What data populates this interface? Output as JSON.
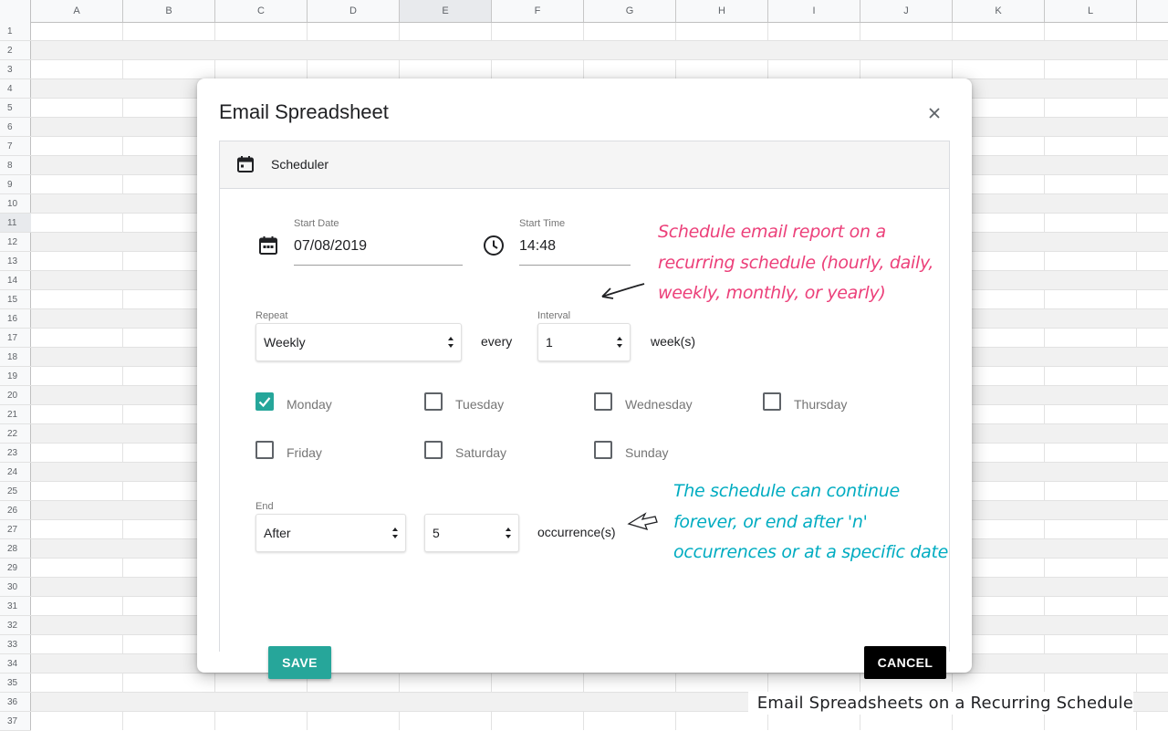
{
  "sheet": {
    "columns": [
      "A",
      "B",
      "C",
      "D",
      "E",
      "F",
      "G",
      "H",
      "I",
      "J",
      "K",
      "L"
    ],
    "selected_column": "E",
    "rows": [
      "1",
      "2",
      "3",
      "4",
      "5",
      "6",
      "7",
      "8",
      "9",
      "10",
      "11",
      "12",
      "13",
      "14",
      "15",
      "16",
      "17",
      "18",
      "19",
      "20",
      "21",
      "22",
      "23",
      "24",
      "25",
      "26",
      "27",
      "28",
      "29",
      "30",
      "31",
      "32",
      "33",
      "34",
      "35",
      "36",
      "37"
    ],
    "selected_row": "11"
  },
  "dialog": {
    "title": "Email Spreadsheet",
    "section_label": "Scheduler",
    "start_date": {
      "label": "Start Date",
      "value": "07/08/2019"
    },
    "start_time": {
      "label": "Start Time",
      "value": "14:48"
    },
    "repeat": {
      "label": "Repeat",
      "value": "Weekly"
    },
    "every_text": "every",
    "interval": {
      "label": "Interval",
      "value": "1"
    },
    "interval_unit": "week(s)",
    "days": [
      {
        "label": "Monday",
        "checked": true
      },
      {
        "label": "Tuesday",
        "checked": false
      },
      {
        "label": "Wednesday",
        "checked": false
      },
      {
        "label": "Thursday",
        "checked": false
      },
      {
        "label": "Friday",
        "checked": false
      },
      {
        "label": "Saturday",
        "checked": false
      },
      {
        "label": "Sunday",
        "checked": false
      }
    ],
    "end": {
      "label": "End",
      "value": "After"
    },
    "occurrences": {
      "value": "5"
    },
    "occurrences_unit": "occurrence(s)",
    "save_label": "SAVE",
    "cancel_label": "CANCEL"
  },
  "annotations": {
    "schedule_note": {
      "lines": [
        "Schedule email report on a",
        "recurring schedule (hourly, daily,",
        "weekly, monthly, or yearly)"
      ],
      "color": "#ec407a"
    },
    "end_note": {
      "lines": [
        "The schedule can continue",
        "forever, or end after 'n'",
        "occurrences or at a specific date"
      ],
      "color": "#00acc1"
    }
  },
  "caption": "Email Spreadsheets on a Recurring Schedule",
  "colors": {
    "accent": "#26a69a",
    "cancel": "#000000",
    "gridline": "#e2e2e2"
  }
}
